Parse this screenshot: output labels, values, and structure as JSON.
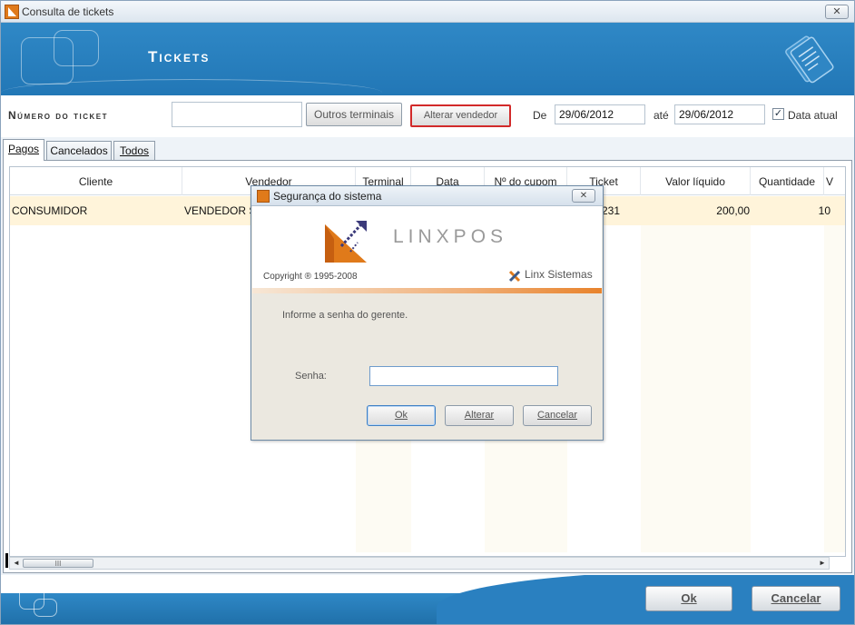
{
  "window": {
    "title": "Consulta de tickets"
  },
  "banner": {
    "heading": "Tickets"
  },
  "filters": {
    "ticket_label": "Número do ticket",
    "ticket_value": "",
    "btn_outros": "Outros terminais",
    "btn_alterar_vendedor": "Alterar vendedor",
    "de_label": "De",
    "date_from": "29/06/2012",
    "ate_label": "até",
    "date_to": "29/06/2012",
    "data_atual_label": "Data atual",
    "data_atual_checked": "✓"
  },
  "tabs": [
    {
      "label": "Pagos",
      "active": true
    },
    {
      "label": "Cancelados",
      "active": false
    },
    {
      "label": "Todos",
      "active": false
    }
  ],
  "grid": {
    "headers": [
      "Cliente",
      "Vendedor",
      "Terminal",
      "Data",
      "Nº do cupom",
      "Ticket",
      "Valor líquido",
      "Quantidade",
      "V"
    ],
    "rows": [
      [
        "CONSUMIDOR",
        "VENDEDOR S",
        "",
        "",
        "",
        "231",
        "200,00",
        "10"
      ]
    ]
  },
  "scrollbar": {
    "thumb_grip": "III",
    "left_arrow": "◄",
    "right_arrow": "►"
  },
  "footer": {
    "ok": "Ok",
    "cancel": "Cancelar"
  },
  "modal": {
    "title": "Segurança do sistema",
    "close": "✕",
    "brand": "LINXPOS",
    "copyright": "Copyright ® 1995-2008",
    "company": "Linx Sistemas",
    "prompt": "Informe a senha do gerente.",
    "senha_label": "Senha:",
    "senha_value": "",
    "btn_ok": "Ok",
    "btn_alterar": "Alterar",
    "btn_cancelar": "Cancelar"
  },
  "colors": {
    "banner_blue": "#2f88c6",
    "accent_orange": "#e07a1a",
    "highlight_red": "#d22a2a",
    "row_highlight": "#fff4da"
  }
}
